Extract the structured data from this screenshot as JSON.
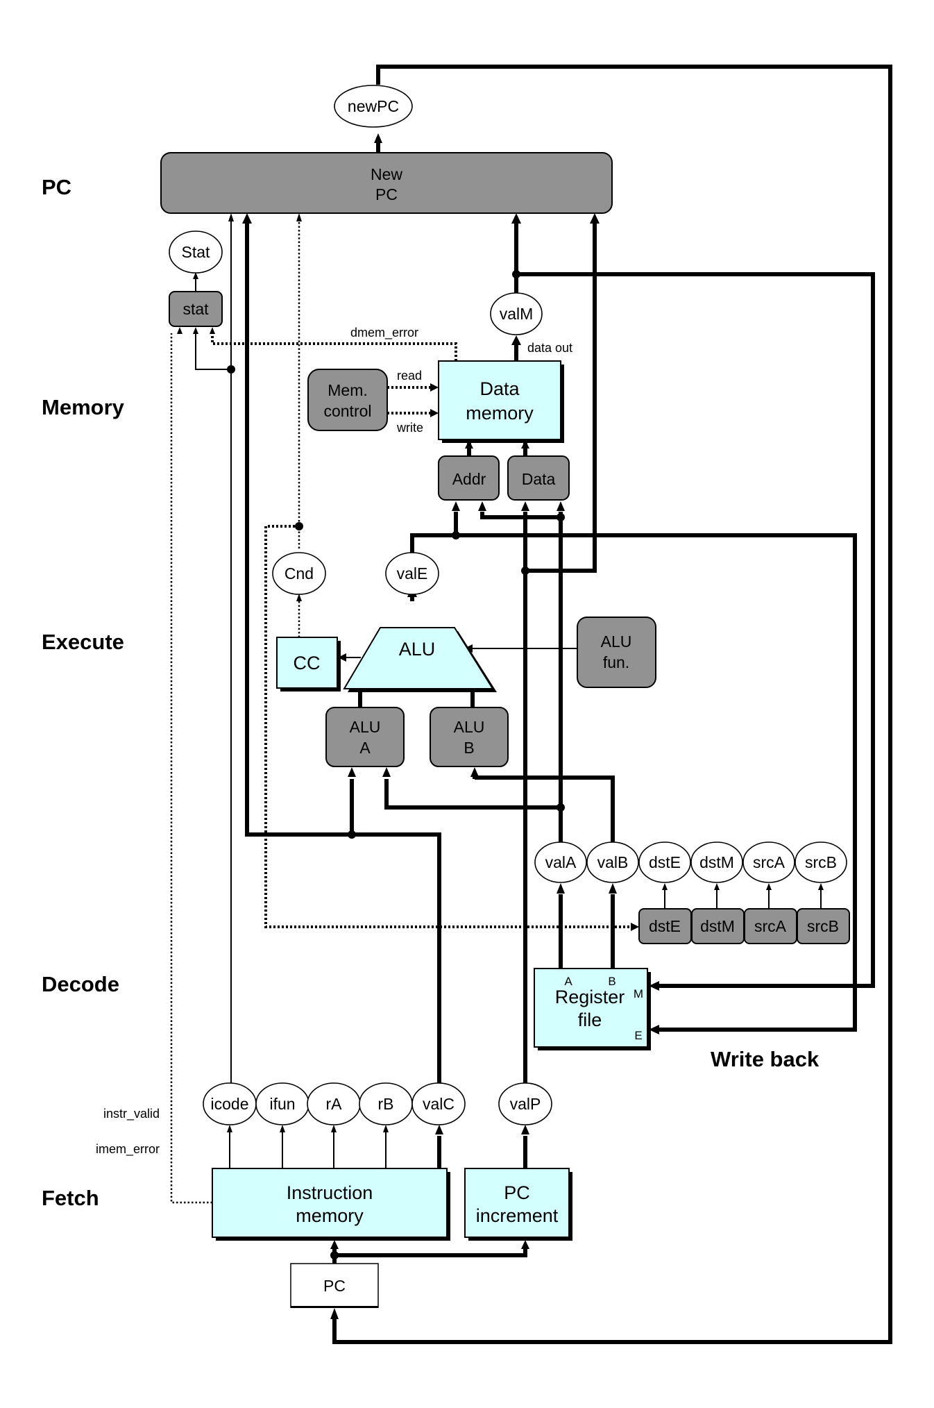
{
  "stages": {
    "pc": "PC",
    "memory": "Memory",
    "execute": "Execute",
    "decode": "Decode",
    "fetch": "Fetch",
    "write_back": "Write back"
  },
  "blocks": {
    "new_pc": [
      "New",
      "PC"
    ],
    "stat": "stat",
    "mem_control": [
      "Mem.",
      "control"
    ],
    "data_memory": [
      "Data",
      "memory"
    ],
    "addr": "Addr",
    "data": "Data",
    "cc": "CC",
    "alu": "ALU",
    "alu_fun": [
      "ALU",
      "fun."
    ],
    "alu_a": [
      "ALU",
      "A"
    ],
    "alu_b": [
      "ALU",
      "B"
    ],
    "register_file": [
      "Register",
      "file"
    ],
    "register_ports": {
      "a": "A",
      "b": "B",
      "m": "M",
      "e": "E"
    },
    "decode_regs": [
      "dstE",
      "dstM",
      "srcA",
      "srcB"
    ],
    "instruction_memory": [
      "Instruction",
      "memory"
    ],
    "pc_increment": [
      "PC",
      "increment"
    ],
    "pc": "PC"
  },
  "signals": {
    "new_pc": "newPC",
    "stat": "Stat",
    "val_m": "valM",
    "cnd": "Cnd",
    "val_e": "valE",
    "decode_outputs": [
      "valA",
      "valB",
      "dstE",
      "dstM",
      "srcA",
      "srcB"
    ],
    "fetch_outputs": [
      "icode",
      "ifun",
      "rA",
      "rB",
      "valC"
    ],
    "val_p": "valP"
  },
  "wire_labels": {
    "dmem_error": "dmem_error",
    "data_out": "data out",
    "read": "read",
    "write": "write",
    "instr_valid": "instr_valid",
    "imem_error": "imem_error"
  },
  "colors": {
    "logic_block": "#929292",
    "hardware_unit": "#d3ffff",
    "wire": "#000000"
  }
}
